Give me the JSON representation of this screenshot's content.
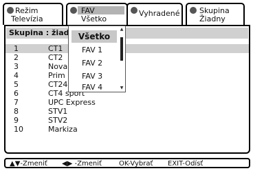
{
  "tabs": [
    {
      "line1": "Režim",
      "line2": "Televízia"
    },
    {
      "line1": "FAV",
      "line2": "Všetko"
    },
    {
      "line1": "Vyhradené",
      "line2": ""
    },
    {
      "line1": "Skupina",
      "line2": "Žiadny"
    }
  ],
  "panel": {
    "header": "Skupina : žiad"
  },
  "channels": [
    {
      "num": "1",
      "name": "CT1"
    },
    {
      "num": "2",
      "name": "CT2"
    },
    {
      "num": "3",
      "name": "Nova"
    },
    {
      "num": "4",
      "name": "Prim"
    },
    {
      "num": "5",
      "name": "CT24"
    },
    {
      "num": "6",
      "name": "CT4 sport"
    },
    {
      "num": "7",
      "name": "UPC Express"
    },
    {
      "num": "8",
      "name": "STV1"
    },
    {
      "num": "9",
      "name": "STV2"
    },
    {
      "num": "10",
      "name": "Markiza"
    }
  ],
  "dropdown": {
    "selected": "Všetko",
    "options": [
      "FAV  1",
      "FAV  2",
      "FAV  3",
      "FAV  4"
    ]
  },
  "help": {
    "change_v": "▲▼-Zmeniť",
    "change_h": "◀▶ -Zmeniť",
    "ok": "OK-Vybrať",
    "exit": "EXIT-Odísť"
  }
}
